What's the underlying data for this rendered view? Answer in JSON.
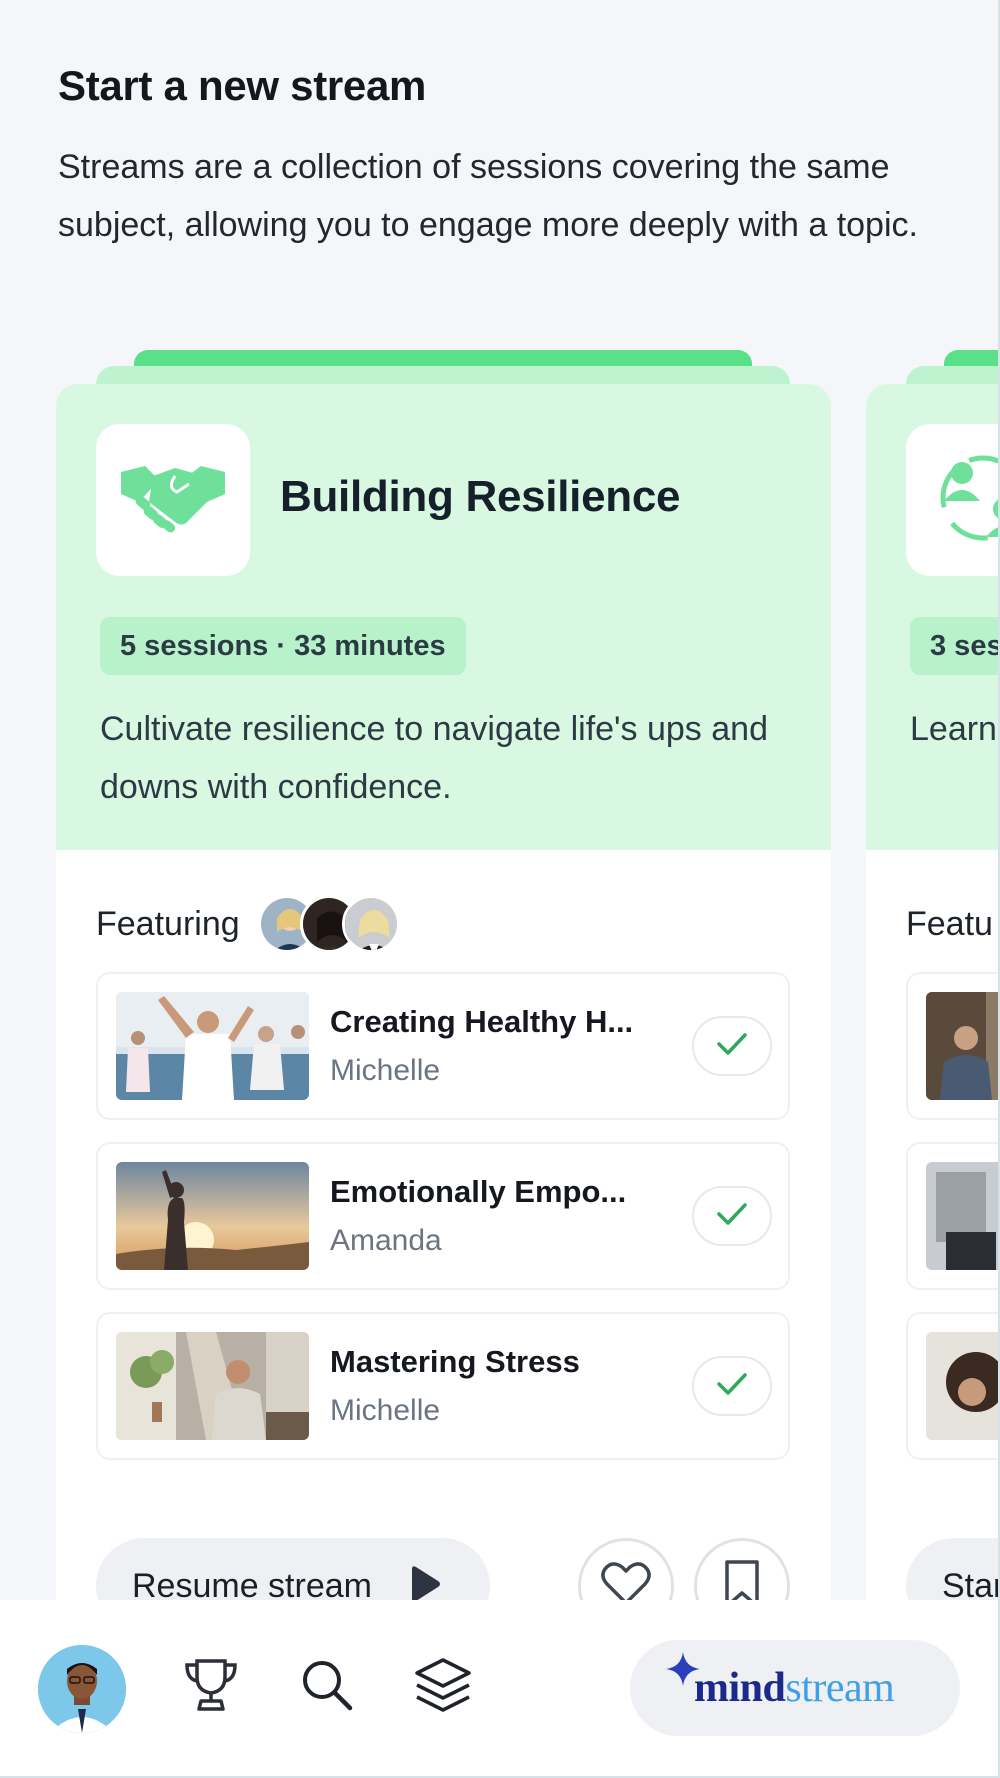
{
  "header": {
    "title": "Start a new stream",
    "subtitle": "Streams are a collection of sessions covering the same subject, allowing you to engage more deeply with a topic."
  },
  "streams": [
    {
      "title": "Building Resilience",
      "icon": "handshake-icon",
      "meta": "5 sessions · 33 minutes",
      "description": "Cultivate resilience to navigate life's ups and downs with confidence.",
      "featuring_label": "Featuring",
      "sessions": [
        {
          "title": "Creating Healthy H...",
          "author": "Michelle",
          "completed": true
        },
        {
          "title": "Emotionally Empo...",
          "author": "Amanda",
          "completed": true
        },
        {
          "title": "Mastering Stress",
          "author": "Michelle",
          "completed": true
        }
      ],
      "action_label": "Resume stream"
    },
    {
      "title": "",
      "icon": "people-connect-icon",
      "meta": "3 ses",
      "description": "Learn",
      "featuring_label": "Featu",
      "action_label": "Star"
    }
  ],
  "logo": {
    "brand_dark": "mind",
    "brand_light": "stream"
  },
  "colors": {
    "accent_green": "#5be08a",
    "card_top": "#d8f8e2",
    "pill": "#b8f2cb",
    "check_green": "#2ea85a",
    "brand_navy": "#1b2a8a",
    "brand_blue": "#3fa0e6"
  }
}
